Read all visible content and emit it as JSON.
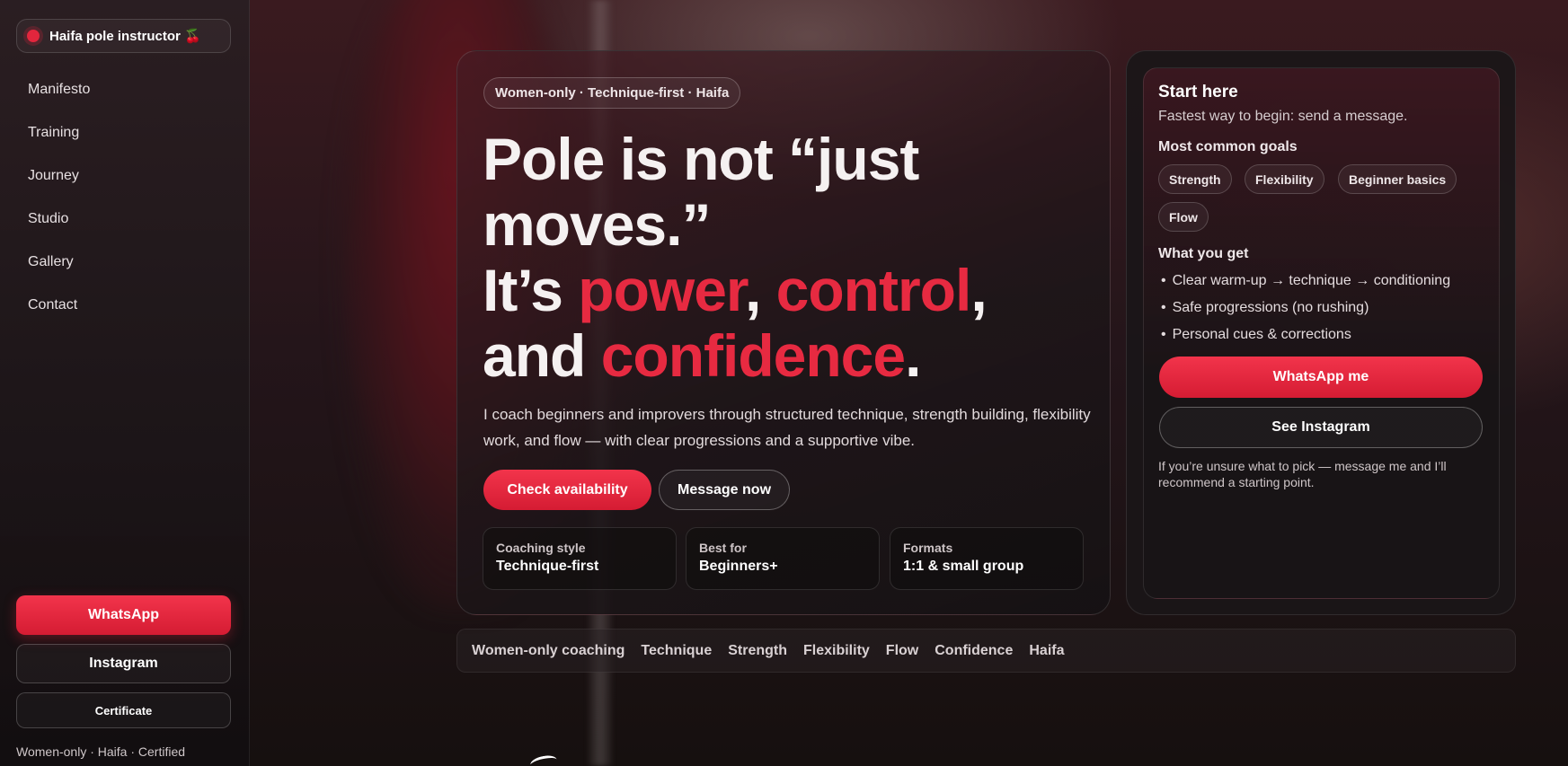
{
  "brand": {
    "name": "Haifa pole instructor 🍒"
  },
  "nav": {
    "items": [
      "Manifesto",
      "Training",
      "Journey",
      "Studio",
      "Gallery",
      "Contact"
    ]
  },
  "sidebar_actions": {
    "whatsapp": "WhatsApp",
    "instagram": "Instagram",
    "certificate": "Certificate"
  },
  "sidebar_footer": "Women-only · Haifa · Certified",
  "hero": {
    "tag": "Women-only · Technique-first · Haifa",
    "headline": {
      "line1": "Pole is not “just moves.”",
      "its": "It’s ",
      "power": "power",
      "comma1": ", ",
      "control": "control",
      "comma2": ",",
      "and": "and ",
      "confidence": "confidence",
      "period": "."
    },
    "lede": "I coach beginners and improvers through structured technique, strength building, flexibility work, and flow — with clear progressions and a supportive vibe.",
    "primary_cta": "Check availability",
    "secondary_cta": "Message now",
    "stats": [
      {
        "label": "Coaching style",
        "value": "Technique-first"
      },
      {
        "label": "Best for",
        "value": "Beginners+"
      },
      {
        "label": "Formats",
        "value": "1:1 & small group"
      }
    ]
  },
  "start": {
    "title": "Start here",
    "subtitle": "Fastest way to begin: send a message.",
    "goals_heading": "Most common goals",
    "goals": [
      "Strength",
      "Flexibility",
      "Beginner basics",
      "Flow"
    ],
    "get_heading": "What you get",
    "benefits": [
      "Clear warm-up → technique → conditioning",
      "Safe progressions (no rushing)",
      "Personal cues & corrections"
    ],
    "whatsapp_cta": "WhatsApp me",
    "instagram_cta": "See Instagram",
    "note": "If you’re unsure what to pick — message me and I’ll recommend a starting point."
  },
  "marquee": [
    "Women-only coaching",
    "Technique",
    "Strength",
    "Flexibility",
    "Flow",
    "Confidence",
    "Haifa"
  ],
  "colors": {
    "accent": "#e72a41",
    "background": "#120d0f"
  }
}
